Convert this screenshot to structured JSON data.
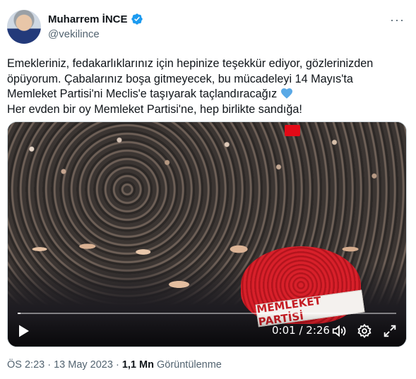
{
  "author": {
    "name": "Muharrem İNCE",
    "handle": "@vekilince",
    "verified": true
  },
  "more_label": "···",
  "tweet": {
    "lines": [
      "Emekleriniz, fedakarlıklarınız için hepinize teşekkür ediyor, gözlerinizden",
      "öpüyorum. Çabalarınız boşa gitmeyecek, bu mücadeleyi 14 Mayıs'ta",
      "Memleket Partisi'ni Meclis'e taşıyarak taçlandıracağız",
      "Her evden bir oy Memleket Partisi'ne, hep birlikte sandığa!"
    ],
    "emoji": "blue-heart"
  },
  "video": {
    "banner_text": "MEMLEKET PARTİSİ",
    "current_time": "0:01",
    "duration": "2:26",
    "time_display": "0:01 / 2:26",
    "progress_fraction": 0.007
  },
  "meta": {
    "time": "ÖS 2:23",
    "separator": " · ",
    "date": "13 May 2023",
    "views_count": "1,1 Mn",
    "views_label": "Görüntülenme"
  },
  "colors": {
    "verified": "#1d9bf0",
    "text": "#0f1419",
    "secondary": "#536471",
    "heart": "#5aa9e6"
  },
  "icons": [
    "verified-badge-icon",
    "more-icon",
    "blue-heart-icon",
    "play-icon",
    "volume-icon",
    "settings-gear-icon",
    "fullscreen-icon"
  ]
}
